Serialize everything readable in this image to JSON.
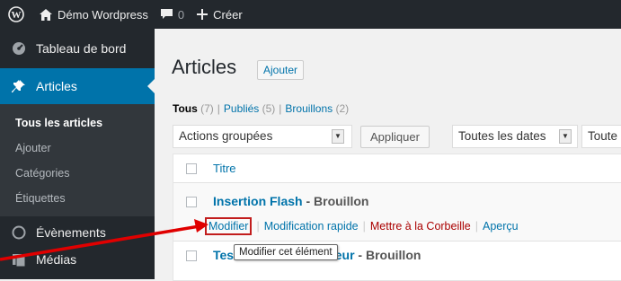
{
  "admin_bar": {
    "site_name": "Démo Wordpress",
    "comments_count": "0",
    "new_label": "Créer"
  },
  "sidebar": {
    "dashboard": "Tableau de bord",
    "articles": "Articles",
    "submenu": [
      "Tous les articles",
      "Ajouter",
      "Catégories",
      "Étiquettes"
    ],
    "events": "Évènements",
    "media": "Médias"
  },
  "main": {
    "title": "Articles",
    "add_button": "Ajouter",
    "filters": [
      {
        "label": "Tous",
        "count": "(7)"
      },
      {
        "label": "Publiés",
        "count": "(5)"
      },
      {
        "label": "Brouillons",
        "count": "(2)"
      }
    ],
    "separator": "|",
    "bulk_actions": "Actions groupées",
    "apply": "Appliquer",
    "all_dates": "Toutes les dates",
    "all_categories": "Toute"
  },
  "table": {
    "col_title": "Titre",
    "rows": [
      {
        "title": "Insertion Flash",
        "state": " - Brouillon"
      },
      {
        "title": "Test",
        "title_tail": "auteur",
        "state": " - Brouillon"
      }
    ],
    "row_actions": {
      "edit": "Modifier",
      "quick_edit": "Modification rapide",
      "trash": "Mettre à la Corbeille",
      "preview": "Aperçu",
      "pipe": "|"
    },
    "tooltip": "Modifier cet élément"
  },
  "colors": {
    "admin_dark": "#23282d",
    "accent_blue": "#0073aa",
    "highlight_red": "#c21d1d",
    "trash_red": "#a00"
  }
}
